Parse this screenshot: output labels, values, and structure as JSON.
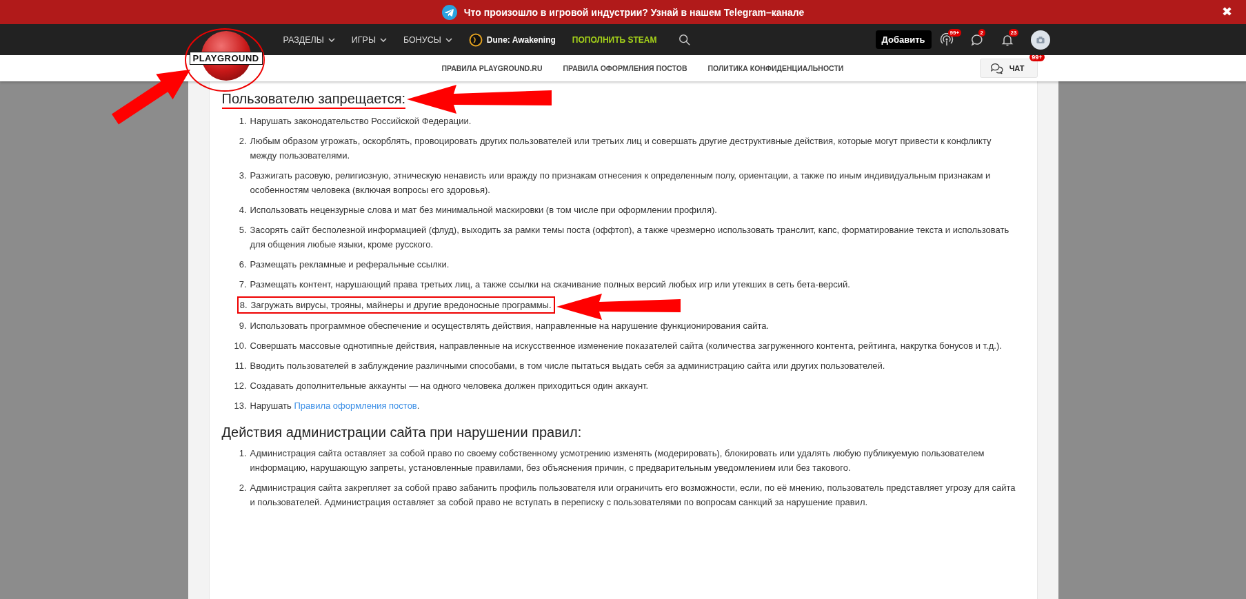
{
  "banner": {
    "text": "Что произошло в игровой индустрии? Узнай в нашем Telegram–канале",
    "close": "✖"
  },
  "logo": {
    "text": "PLAYGROUND",
    "circled": true,
    "arrow": true
  },
  "nav": [
    {
      "label": "РАЗДЕЛЫ",
      "kind": "menu"
    },
    {
      "label": "ИГРЫ",
      "kind": "menu"
    },
    {
      "label": "БОНУСЫ",
      "kind": "menu"
    },
    {
      "label": "Dune: Awakening",
      "kind": "game"
    },
    {
      "label": "ПОПОЛНИТЬ STEAM",
      "kind": "promo"
    }
  ],
  "header_actions": {
    "add_button": "Добавить",
    "icons": [
      {
        "kind": "broadcast",
        "badge": "99+"
      },
      {
        "kind": "chat",
        "badge": "2"
      },
      {
        "kind": "bell",
        "badge": "23"
      }
    ]
  },
  "subnav": [
    "ПРАВИЛА PLAYGROUND.RU",
    "ПРАВИЛА ОФОРМЛЕНИЯ ПОСТОВ",
    "ПОЛИТИКА КОНФИДЕНЦИАЛЬНОСТИ"
  ],
  "chat_button": {
    "label": "ЧАТ",
    "badge": "99+"
  },
  "sections": [
    {
      "heading": "Пользователю запрещается:",
      "highlighted": true,
      "items": [
        {
          "number": "1.",
          "text": "Нарушать законодательство Российской Федерации.",
          "highlighted": false
        },
        {
          "number": "2.",
          "text": "Любым образом угрожать, оскорблять, провоцировать других пользователей или третьих лиц и совершать другие деструктивные действия, которые могут привести к конфликту между пользователями.",
          "highlighted": false
        },
        {
          "number": "3.",
          "text": "Разжигать расовую, религиозную, этническую ненависть или вражду по признакам отнесения к определенным полу, ориентации, а также по иным индивидуальным признакам и особенностям человека (включая вопросы его здоровья).",
          "highlighted": false
        },
        {
          "number": "4.",
          "text": "Использовать нецензурные слова и мат без минимальной маскировки (в том числе при оформлении профиля).",
          "highlighted": false
        },
        {
          "number": "5.",
          "text": "Засорять сайт бесполезной информацией (флуд), выходить за рамки темы поста (оффтоп), а также чрезмерно использовать транслит, капс, форматирование текста и использовать для общения любые языки, кроме русского.",
          "highlighted": false
        },
        {
          "number": "6.",
          "text": "Размещать рекламные и реферальные ссылки.",
          "highlighted": false
        },
        {
          "number": "7.",
          "text": "Размещать контент, нарушающий права третьих лиц, а также ссылки на скачивание полных версий любых игр или утекших в сеть бета-версий.",
          "highlighted": false
        },
        {
          "number": "8.",
          "text": "Загружать вирусы, трояны, майнеры и другие вредоносные программы.",
          "highlighted": true
        },
        {
          "number": "9.",
          "text": "Использовать программное обеспечение и осуществлять действия, направленные на нарушение функционирования сайта.",
          "highlighted": false
        },
        {
          "number": "10.",
          "text": "Совершать массовые однотипные действия, направленные на искусственное изменение показателей сайта (количества загруженного контента, рейтинга, накрутка бонусов и т.д.).",
          "highlighted": false
        },
        {
          "number": "11.",
          "text": "Вводить пользователей в заблуждение различными способами, в том числе пытаться выдать себя за администрацию сайта или других пользователей.",
          "highlighted": false
        },
        {
          "number": "12.",
          "text": "Создавать дополнительные аккаунты — на одного человека должен приходиться один аккаунт.",
          "highlighted": false
        },
        {
          "number": "13.",
          "text": "Нарушать ",
          "link": "Правила оформления постов",
          "after": ".",
          "highlighted": false
        }
      ]
    },
    {
      "heading": "Действия администрации сайта при нарушении правил:",
      "highlighted": false,
      "items": [
        {
          "number": "1.",
          "text": "Администрация сайта оставляет за собой право по своему собственному усмотрению изменять (модерировать), блокировать или удалять любую публикуемую пользователем информацию, нарушающую запреты, установленные правилами, без объяснения причин, с предварительным уведомлением или без такового.",
          "highlighted": false
        },
        {
          "number": "2.",
          "text": "Администрация сайта закрепляет за собой право забанить профиль пользователя или ограничить его возможности, если, по её мнению, пользователь представляет угрозу для сайта и пользователей. Администрация оставляет за собой право не вступать в переписку с пользователями по вопросам санкций за нарушение правил.",
          "highlighted": false
        }
      ]
    }
  ]
}
